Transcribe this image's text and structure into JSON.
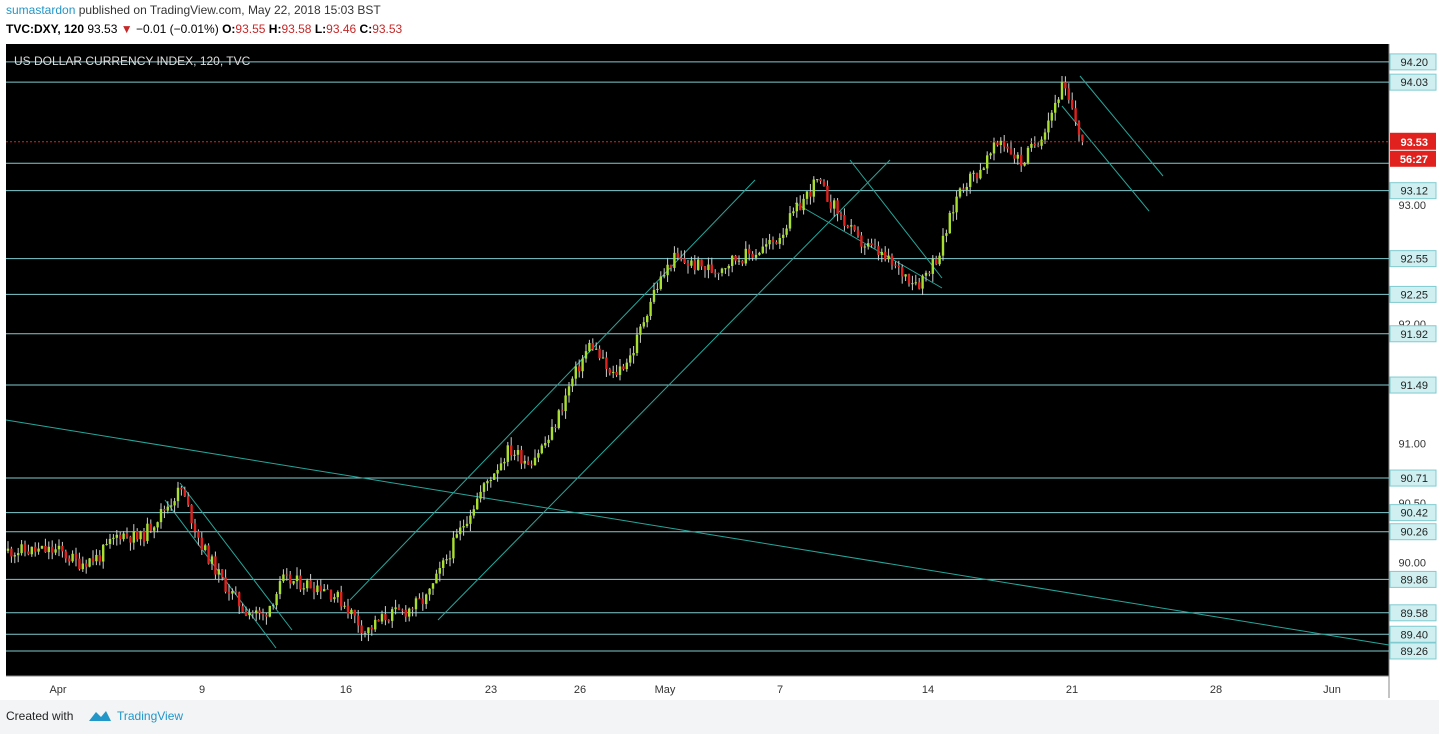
{
  "header": {
    "author": "sumastardon",
    "published_text": "published on TradingView.com, May 22, 2018 15:03 BST",
    "symbol": "TVC:DXY, 120",
    "last": "93.53",
    "change": "−0.01 (−0.01%)",
    "ohlc": {
      "o_label": "O:",
      "o": "93.55",
      "h_label": "H:",
      "h": "93.58",
      "l_label": "L:",
      "l": "93.46",
      "c_label": "C:",
      "c": "93.53"
    }
  },
  "footer": {
    "created_with": "Created with",
    "brand": "TradingView"
  },
  "colors": {
    "background": "#000000",
    "up_candle": "#a8e030",
    "down_candle": "#e0211d",
    "level_line": "#80cbd0",
    "trend_line": "#26a69a",
    "current_price": "#e0211d"
  },
  "chart_data": {
    "type": "candlestick",
    "title": "US DOLLAR CURRENCY INDEX, 120, TVC",
    "x_tick_labels": [
      "Apr",
      "9",
      "16",
      "23",
      "26",
      "May",
      "7",
      "14",
      "21",
      "28",
      "Jun"
    ],
    "y_tick_labels": [
      "93.00",
      "92.00",
      "91.00",
      "90.50",
      "90.00"
    ],
    "horizontal_levels": [
      94.2,
      94.03,
      93.35,
      93.12,
      92.55,
      92.25,
      91.92,
      91.49,
      90.71,
      90.42,
      90.26,
      89.86,
      89.58,
      89.4,
      89.26
    ],
    "level_labels": [
      "94.20",
      "94.03",
      "93.12",
      "92.55",
      "92.25",
      "91.92",
      "91.49",
      "90.71",
      "90.42",
      "90.26",
      "89.86",
      "89.58",
      "89.40",
      "89.26"
    ],
    "current_price": {
      "value": 93.53,
      "label": "93.53",
      "countdown": "56:27"
    },
    "ylim": [
      89.05,
      94.35
    ],
    "grid": false,
    "close_path": [
      {
        "d": "2018-04-02",
        "v": 90.1
      },
      {
        "d": "2018-04-03",
        "v": 90.0
      },
      {
        "d": "2018-04-04",
        "v": 90.05
      },
      {
        "d": "2018-04-05",
        "v": 90.25
      },
      {
        "d": "2018-04-06",
        "v": 90.2
      },
      {
        "d": "2018-04-08",
        "v": 90.62
      },
      {
        "d": "2018-04-09",
        "v": 90.15
      },
      {
        "d": "2018-04-10",
        "v": 89.85
      },
      {
        "d": "2018-04-11",
        "v": 89.62
      },
      {
        "d": "2018-04-12",
        "v": 89.55
      },
      {
        "d": "2018-04-13",
        "v": 89.85
      },
      {
        "d": "2018-04-15",
        "v": 89.8
      },
      {
        "d": "2018-04-16",
        "v": 89.65
      },
      {
        "d": "2018-04-17",
        "v": 89.42
      },
      {
        "d": "2018-04-18",
        "v": 89.55
      },
      {
        "d": "2018-04-19",
        "v": 89.6
      },
      {
        "d": "2018-04-20",
        "v": 89.7
      },
      {
        "d": "2018-04-21",
        "v": 90.05
      },
      {
        "d": "2018-04-22",
        "v": 90.4
      },
      {
        "d": "2018-04-23",
        "v": 90.7
      },
      {
        "d": "2018-04-24",
        "v": 90.95
      },
      {
        "d": "2018-04-25",
        "v": 90.85
      },
      {
        "d": "2018-04-26",
        "v": 91.05
      },
      {
        "d": "2018-04-27",
        "v": 91.5
      },
      {
        "d": "2018-04-28",
        "v": 91.85
      },
      {
        "d": "2018-04-29",
        "v": 91.55
      },
      {
        "d": "2018-04-30",
        "v": 91.75
      },
      {
        "d": "2018-05-01",
        "v": 92.25
      },
      {
        "d": "2018-05-02",
        "v": 92.55
      },
      {
        "d": "2018-05-03",
        "v": 92.5
      },
      {
        "d": "2018-05-04",
        "v": 92.45
      },
      {
        "d": "2018-05-05",
        "v": 92.55
      },
      {
        "d": "2018-05-06",
        "v": 92.6
      },
      {
        "d": "2018-05-07",
        "v": 92.7
      },
      {
        "d": "2018-05-08",
        "v": 92.95
      },
      {
        "d": "2018-05-09",
        "v": 93.2
      },
      {
        "d": "2018-05-10",
        "v": 92.95
      },
      {
        "d": "2018-05-11",
        "v": 92.7
      },
      {
        "d": "2018-05-12",
        "v": 92.6
      },
      {
        "d": "2018-05-13",
        "v": 92.45
      },
      {
        "d": "2018-05-14",
        "v": 92.35
      },
      {
        "d": "2018-05-15",
        "v": 92.6
      },
      {
        "d": "2018-05-16",
        "v": 93.15
      },
      {
        "d": "2018-05-17",
        "v": 93.3
      },
      {
        "d": "2018-05-18",
        "v": 93.55
      },
      {
        "d": "2018-05-19",
        "v": 93.35
      },
      {
        "d": "2018-05-20",
        "v": 93.6
      },
      {
        "d": "2018-05-21",
        "v": 94.0
      },
      {
        "d": "2018-05-22",
        "v": 93.53
      }
    ]
  }
}
